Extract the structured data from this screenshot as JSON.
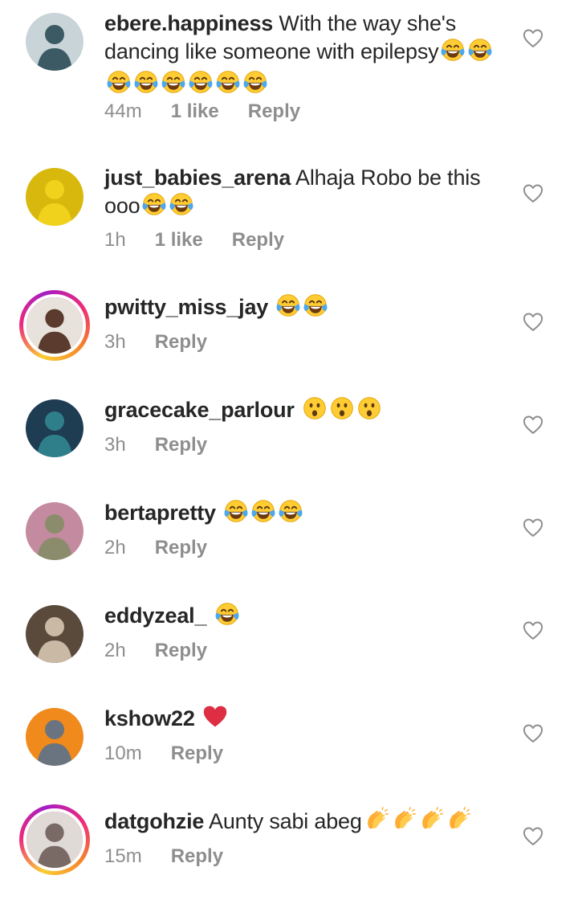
{
  "comments": [
    {
      "username": "ebere.happiness",
      "text": "With the way she's dancing like someone with epilepsy",
      "emojis": [
        "laugh-cry",
        "laugh-cry",
        "laugh-cry",
        "laugh-cry",
        "laugh-cry",
        "laugh-cry",
        "laugh-cry",
        "laugh-cry"
      ],
      "time": "44m",
      "likes": "1 like",
      "reply": "Reply",
      "story_ring": false,
      "avatar_colors": [
        "#3b5a63",
        "#c8d4d8"
      ]
    },
    {
      "username": "just_babies_arena",
      "text": "Alhaja Robo be this ooo",
      "emojis": [
        "laugh-cry",
        "laugh-cry"
      ],
      "time": "1h",
      "likes": "1 like",
      "reply": "Reply",
      "story_ring": false,
      "avatar_colors": [
        "#f0d21c",
        "#d8b80c"
      ]
    },
    {
      "username": "pwitty_miss_jay",
      "text": "",
      "emojis": [
        "laugh-cry",
        "laugh-cry"
      ],
      "time": "3h",
      "likes": "",
      "reply": "Reply",
      "story_ring": true,
      "avatar_colors": [
        "#5a3b2d",
        "#e8e2dc"
      ]
    },
    {
      "username": "gracecake_parlour",
      "text": "",
      "emojis": [
        "surprised",
        "surprised",
        "surprised"
      ],
      "time": "3h",
      "likes": "",
      "reply": "Reply",
      "story_ring": false,
      "avatar_colors": [
        "#2f7f8a",
        "#1e3c52"
      ]
    },
    {
      "username": "bertapretty",
      "text": "",
      "emojis": [
        "laugh-cry",
        "laugh-cry",
        "laugh-cry"
      ],
      "time": "2h",
      "likes": "",
      "reply": "Reply",
      "story_ring": false,
      "avatar_colors": [
        "#8a8c6c",
        "#c48aa0"
      ]
    },
    {
      "username": "eddyzeal_",
      "text": "",
      "emojis": [
        "laugh-cry"
      ],
      "time": "2h",
      "likes": "",
      "reply": "Reply",
      "story_ring": false,
      "avatar_colors": [
        "#c9b9a5",
        "#5a4a3c"
      ]
    },
    {
      "username": "kshow22",
      "text": "",
      "emojis": [
        "red-heart"
      ],
      "time": "10m",
      "likes": "",
      "reply": "Reply",
      "story_ring": false,
      "avatar_colors": [
        "#6a7480",
        "#f08a1c"
      ]
    },
    {
      "username": "datgohzie",
      "text": "Aunty sabi abeg",
      "emojis": [
        "clapping-hands",
        "clapping-hands",
        "clapping-hands",
        "clapping-hands"
      ],
      "time": "15m",
      "likes": "",
      "reply": "Reply",
      "story_ring": true,
      "avatar_colors": [
        "#7a6a66",
        "#e0dad6"
      ]
    }
  ],
  "colors": {
    "username": "#262626",
    "meta": "#8e8e8e",
    "heart_outline": "#8e8e8e",
    "story_ring": [
      "#f9ce34",
      "#ee2a7b",
      "#a51dc4"
    ]
  },
  "icons": {
    "like": "heart-outline-icon"
  }
}
